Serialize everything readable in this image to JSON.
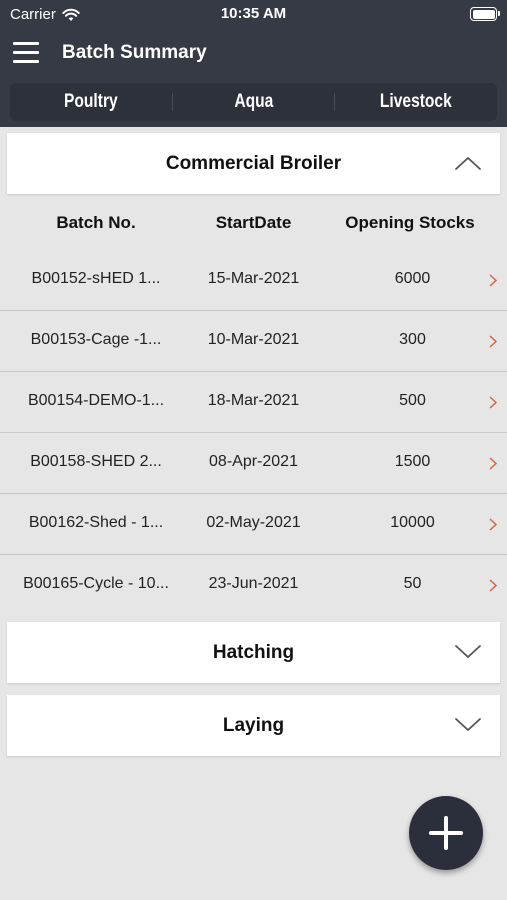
{
  "status_bar": {
    "carrier": "Carrier",
    "time": "10:35 AM",
    "icons": [
      "wifi-icon",
      "battery-icon"
    ]
  },
  "nav": {
    "title": "Batch Summary",
    "menu_icon": "hamburger-menu-icon"
  },
  "tabs": [
    {
      "label": "Poultry"
    },
    {
      "label": "Aqua"
    },
    {
      "label": "Livestock"
    }
  ],
  "sections": {
    "commercial_broiler": {
      "title": "Commercial Broiler",
      "state": "expanded",
      "chevron_icon": "chevron-up-icon"
    },
    "hatching": {
      "title": "Hatching",
      "state": "collapsed",
      "chevron_icon": "chevron-down-icon"
    },
    "laying": {
      "title": "Laying",
      "state": "collapsed",
      "chevron_icon": "chevron-down-icon"
    }
  },
  "table": {
    "headers": [
      "Batch No.",
      "StartDate",
      "Opening Stocks"
    ],
    "rows": [
      {
        "batch": "B00152-sHED 1...",
        "start_date": "15-Mar-2021",
        "opening_stock": "6000"
      },
      {
        "batch": "B00153-Cage -1...",
        "start_date": "10-Mar-2021",
        "opening_stock": "300"
      },
      {
        "batch": "B00154-DEMO-1...",
        "start_date": "18-Mar-2021",
        "opening_stock": "500"
      },
      {
        "batch": "B00158-SHED 2...",
        "start_date": "08-Apr-2021",
        "opening_stock": "1500"
      },
      {
        "batch": "B00162-Shed - 1...",
        "start_date": "02-May-2021",
        "opening_stock": "10000"
      },
      {
        "batch": "B00165-Cycle - 10...",
        "start_date": "23-Jun-2021",
        "opening_stock": "50"
      }
    ],
    "row_chevron_icon": "chevron-right-icon"
  },
  "fab": {
    "icon": "plus-icon"
  },
  "colors": {
    "header_bg": "#363a45",
    "tab_bg": "#2d3139",
    "page_bg": "#e6e6e6",
    "row_chevron": "#d9644a",
    "fab_bg": "#2b2f3b"
  }
}
